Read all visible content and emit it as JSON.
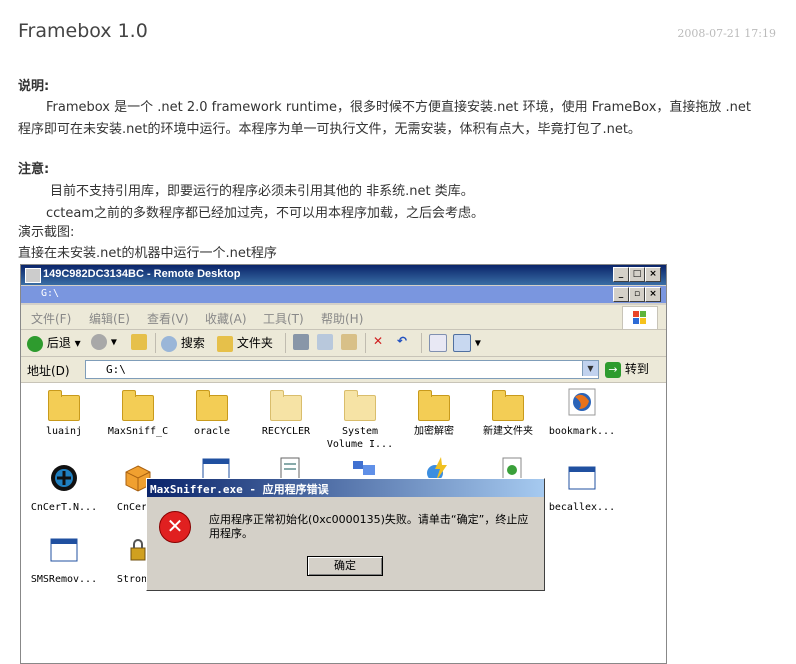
{
  "post": {
    "title": "Framebox 1.0",
    "date": "2008-07-21 17:19",
    "desc_heading": "说明:",
    "desc_line1": "Framebox 是一个 .net 2.0 framework runtime，很多时候不方便直接安装.net 环境，使用 FrameBox，直接拖放 .net",
    "desc_line2": "程序即可在未安装.net的环境中运行。本程序为单一可执行文件，无需安装，体积有点大，毕竟打包了.net。",
    "note_heading": "注意:",
    "note_line1": "目前不支持引用库，即要运行的程序必须未引用其他的 非系统.net 类库。",
    "note_line2": "ccteam之前的多数程序都已经加过壳，不可以用本程序加载，之后会考虑。",
    "screenshot_label": "演示截图:",
    "screenshot_caption": "直接在未安装.net的机器中运行一个.net程序"
  },
  "remote_window": {
    "title": "149C982DC3134BC - Remote Desktop",
    "btn_min": "_",
    "btn_max": "□",
    "btn_close": "×",
    "sub_title": "G:\\",
    "sub_btn_restore": "▫"
  },
  "menu": [
    "文件(F)",
    "编辑(E)",
    "查看(V)",
    "收藏(A)",
    "工具(T)",
    "帮助(H)"
  ],
  "toolbar": {
    "back": "后退",
    "search": "搜索",
    "folders": "文件夹"
  },
  "address": {
    "label": "地址(D)",
    "value": "G:\\",
    "go": "转到"
  },
  "files": [
    "luainj",
    "MaxSniff_C",
    "oracle",
    "RECYCLER",
    "System",
    "Volume I...",
    "加密解密",
    "新建文件夹",
    "bookmark...",
    "CnCerT.N...",
    "CnCerT.",
    "becallex...",
    "SMSRemov...",
    "StrongN"
  ],
  "dialog": {
    "title": "MaxSniffer.exe - 应用程序错误",
    "message": "应用程序正常初始化(0xc0000135)失败。请单击“确定”，终止应用程序。",
    "ok": "确定"
  }
}
